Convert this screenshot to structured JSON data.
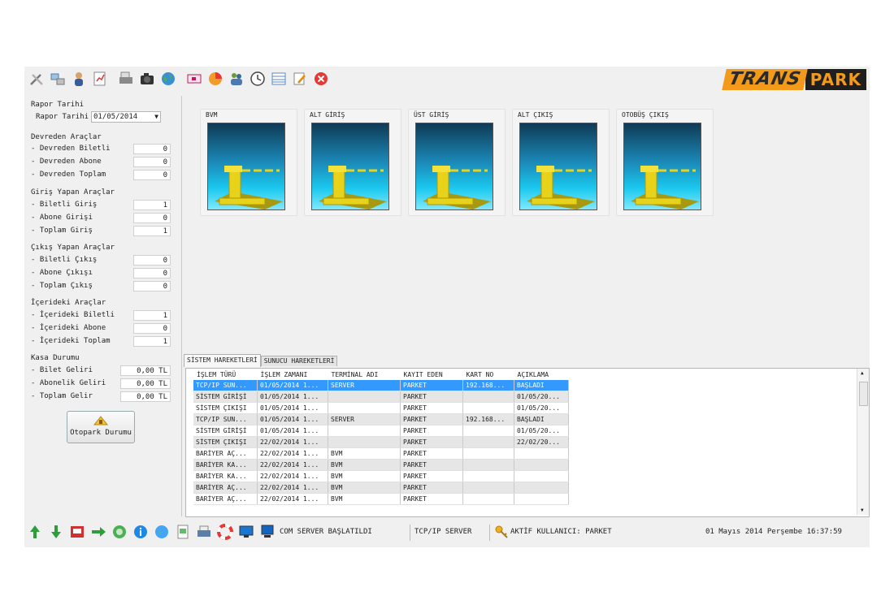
{
  "logo": {
    "part1": "TRANS",
    "part2": "PARK"
  },
  "toolbar": {
    "icons": [
      "tools-icon",
      "network-icon",
      "user-icon",
      "report-icon",
      "printer-icon",
      "camera-icon",
      "globe-icon",
      "card-icon",
      "pie-chart-icon",
      "users-icon",
      "clock-icon",
      "table-icon",
      "edit-icon",
      "close-icon"
    ]
  },
  "left": {
    "rapor_group": "Rapor Tarihi",
    "rapor_label": "Rapor Tarihi",
    "rapor_value": "01/05/2014",
    "devreden": {
      "title": "Devreden Araçlar",
      "rows": [
        {
          "label": "- Devreden Biletli",
          "value": "0"
        },
        {
          "label": "- Devreden Abone",
          "value": "0"
        },
        {
          "label": "- Devreden Toplam",
          "value": "0"
        }
      ]
    },
    "giris": {
      "title": "Giriş Yapan Araçlar",
      "rows": [
        {
          "label": "- Biletli Giriş",
          "value": "1"
        },
        {
          "label": "- Abone Girişi",
          "value": "0"
        },
        {
          "label": "- Toplam Giriş",
          "value": "1"
        }
      ]
    },
    "cikis": {
      "title": "Çıkış Yapan Araçlar",
      "rows": [
        {
          "label": "- Biletli Çıkış",
          "value": "0"
        },
        {
          "label": "- Abone Çıkışı",
          "value": "0"
        },
        {
          "label": "- Toplam Çıkış",
          "value": "0"
        }
      ]
    },
    "iceride": {
      "title": "İçerideki Araçlar",
      "rows": [
        {
          "label": "- İçerideki Biletli",
          "value": "1"
        },
        {
          "label": "- İçerideki Abone",
          "value": "0"
        },
        {
          "label": "- İçerideki Toplam",
          "value": "1"
        }
      ]
    },
    "kasa": {
      "title": "Kasa Durumu",
      "rows": [
        {
          "label": "- Bilet Geliri",
          "value": "0,00 TL"
        },
        {
          "label": "- Abonelik Geliri",
          "value": "0,00 TL"
        },
        {
          "label": "- Toplam Gelir",
          "value": "0,00 TL"
        }
      ]
    },
    "otopark_button": "Otopark Durumu"
  },
  "barriers": [
    "BVM",
    "ALT GİRİŞ",
    "ÜST GİRİŞ",
    "ALT ÇIKIŞ",
    "OTOBÜŞ ÇIKIŞ"
  ],
  "tabs": [
    "SİSTEM HAREKETLERİ",
    "SUNUCU HAREKETLERİ"
  ],
  "grid": {
    "columns": [
      "İŞLEM TÜRÜ",
      "İŞLEM ZAMANI",
      "TERMİNAL ADI",
      "KAYIT EDEN",
      "KART NO",
      "AÇIKLAMA"
    ],
    "rows": [
      [
        "TCP/IP SUN...",
        "01/05/2014 1...",
        "SERVER",
        "PARKET",
        "192.168...",
        "BAŞLADI"
      ],
      [
        "SİSTEM GİRİŞİ",
        "01/05/2014 1...",
        "",
        "PARKET",
        "",
        "01/05/20..."
      ],
      [
        "SİSTEM ÇIKIŞI",
        "01/05/2014 1...",
        "",
        "PARKET",
        "",
        "01/05/20..."
      ],
      [
        "TCP/IP SUN...",
        "01/05/2014 1...",
        "SERVER",
        "PARKET",
        "192.168...",
        "BAŞLADI"
      ],
      [
        "SİSTEM GİRİŞİ",
        "01/05/2014 1...",
        "",
        "PARKET",
        "",
        "01/05/20..."
      ],
      [
        "SİSTEM ÇIKIŞI",
        "22/02/2014 1...",
        "",
        "PARKET",
        "",
        "22/02/20..."
      ],
      [
        "BARİYER AÇ...",
        "22/02/2014 1...",
        "BVM",
        "PARKET",
        "",
        ""
      ],
      [
        "BARİYER KA...",
        "22/02/2014 1...",
        "BVM",
        "PARKET",
        "",
        ""
      ],
      [
        "BARİYER KA...",
        "22/02/2014 1...",
        "BVM",
        "PARKET",
        "",
        ""
      ],
      [
        "BARİYER AÇ...",
        "22/02/2014 1...",
        "BVM",
        "PARKET",
        "",
        ""
      ],
      [
        "BARİYER AÇ...",
        "22/02/2014 1...",
        "BVM",
        "PARKET",
        "",
        ""
      ]
    ]
  },
  "status": {
    "com": "COM SERVER BAŞLATILDI",
    "tcp": "TCP/IP SERVER",
    "user": "AKTİF KULLANICI: PARKET",
    "datetime": "01 Mayıs 2014 Perşembe 16:37:59"
  },
  "colors": {
    "selection": "#3399ff",
    "logo_orange": "#f39a1a",
    "barrier_yellow": "#e8d21a"
  }
}
